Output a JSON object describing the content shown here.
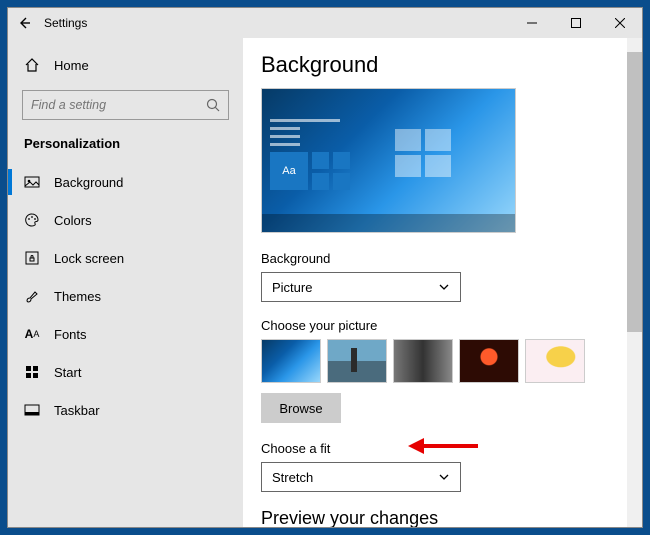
{
  "window": {
    "title": "Settings"
  },
  "sidebar": {
    "home": "Home",
    "search_placeholder": "Find a setting",
    "category": "Personalization",
    "items": [
      {
        "label": "Background",
        "icon": "picture-icon",
        "active": true
      },
      {
        "label": "Colors",
        "icon": "palette-icon",
        "active": false
      },
      {
        "label": "Lock screen",
        "icon": "lock-frame-icon",
        "active": false
      },
      {
        "label": "Themes",
        "icon": "brush-icon",
        "active": false
      },
      {
        "label": "Fonts",
        "icon": "fonts-icon",
        "active": false
      },
      {
        "label": "Start",
        "icon": "start-icon",
        "active": false
      },
      {
        "label": "Taskbar",
        "icon": "taskbar-icon",
        "active": false
      }
    ]
  },
  "main": {
    "title": "Background",
    "preview_tile_text": "Aa",
    "bg_label": "Background",
    "bg_value": "Picture",
    "choose_pic_label": "Choose your picture",
    "browse_label": "Browse",
    "fit_label": "Choose a fit",
    "fit_value": "Stretch",
    "preview_changes": "Preview your changes"
  }
}
